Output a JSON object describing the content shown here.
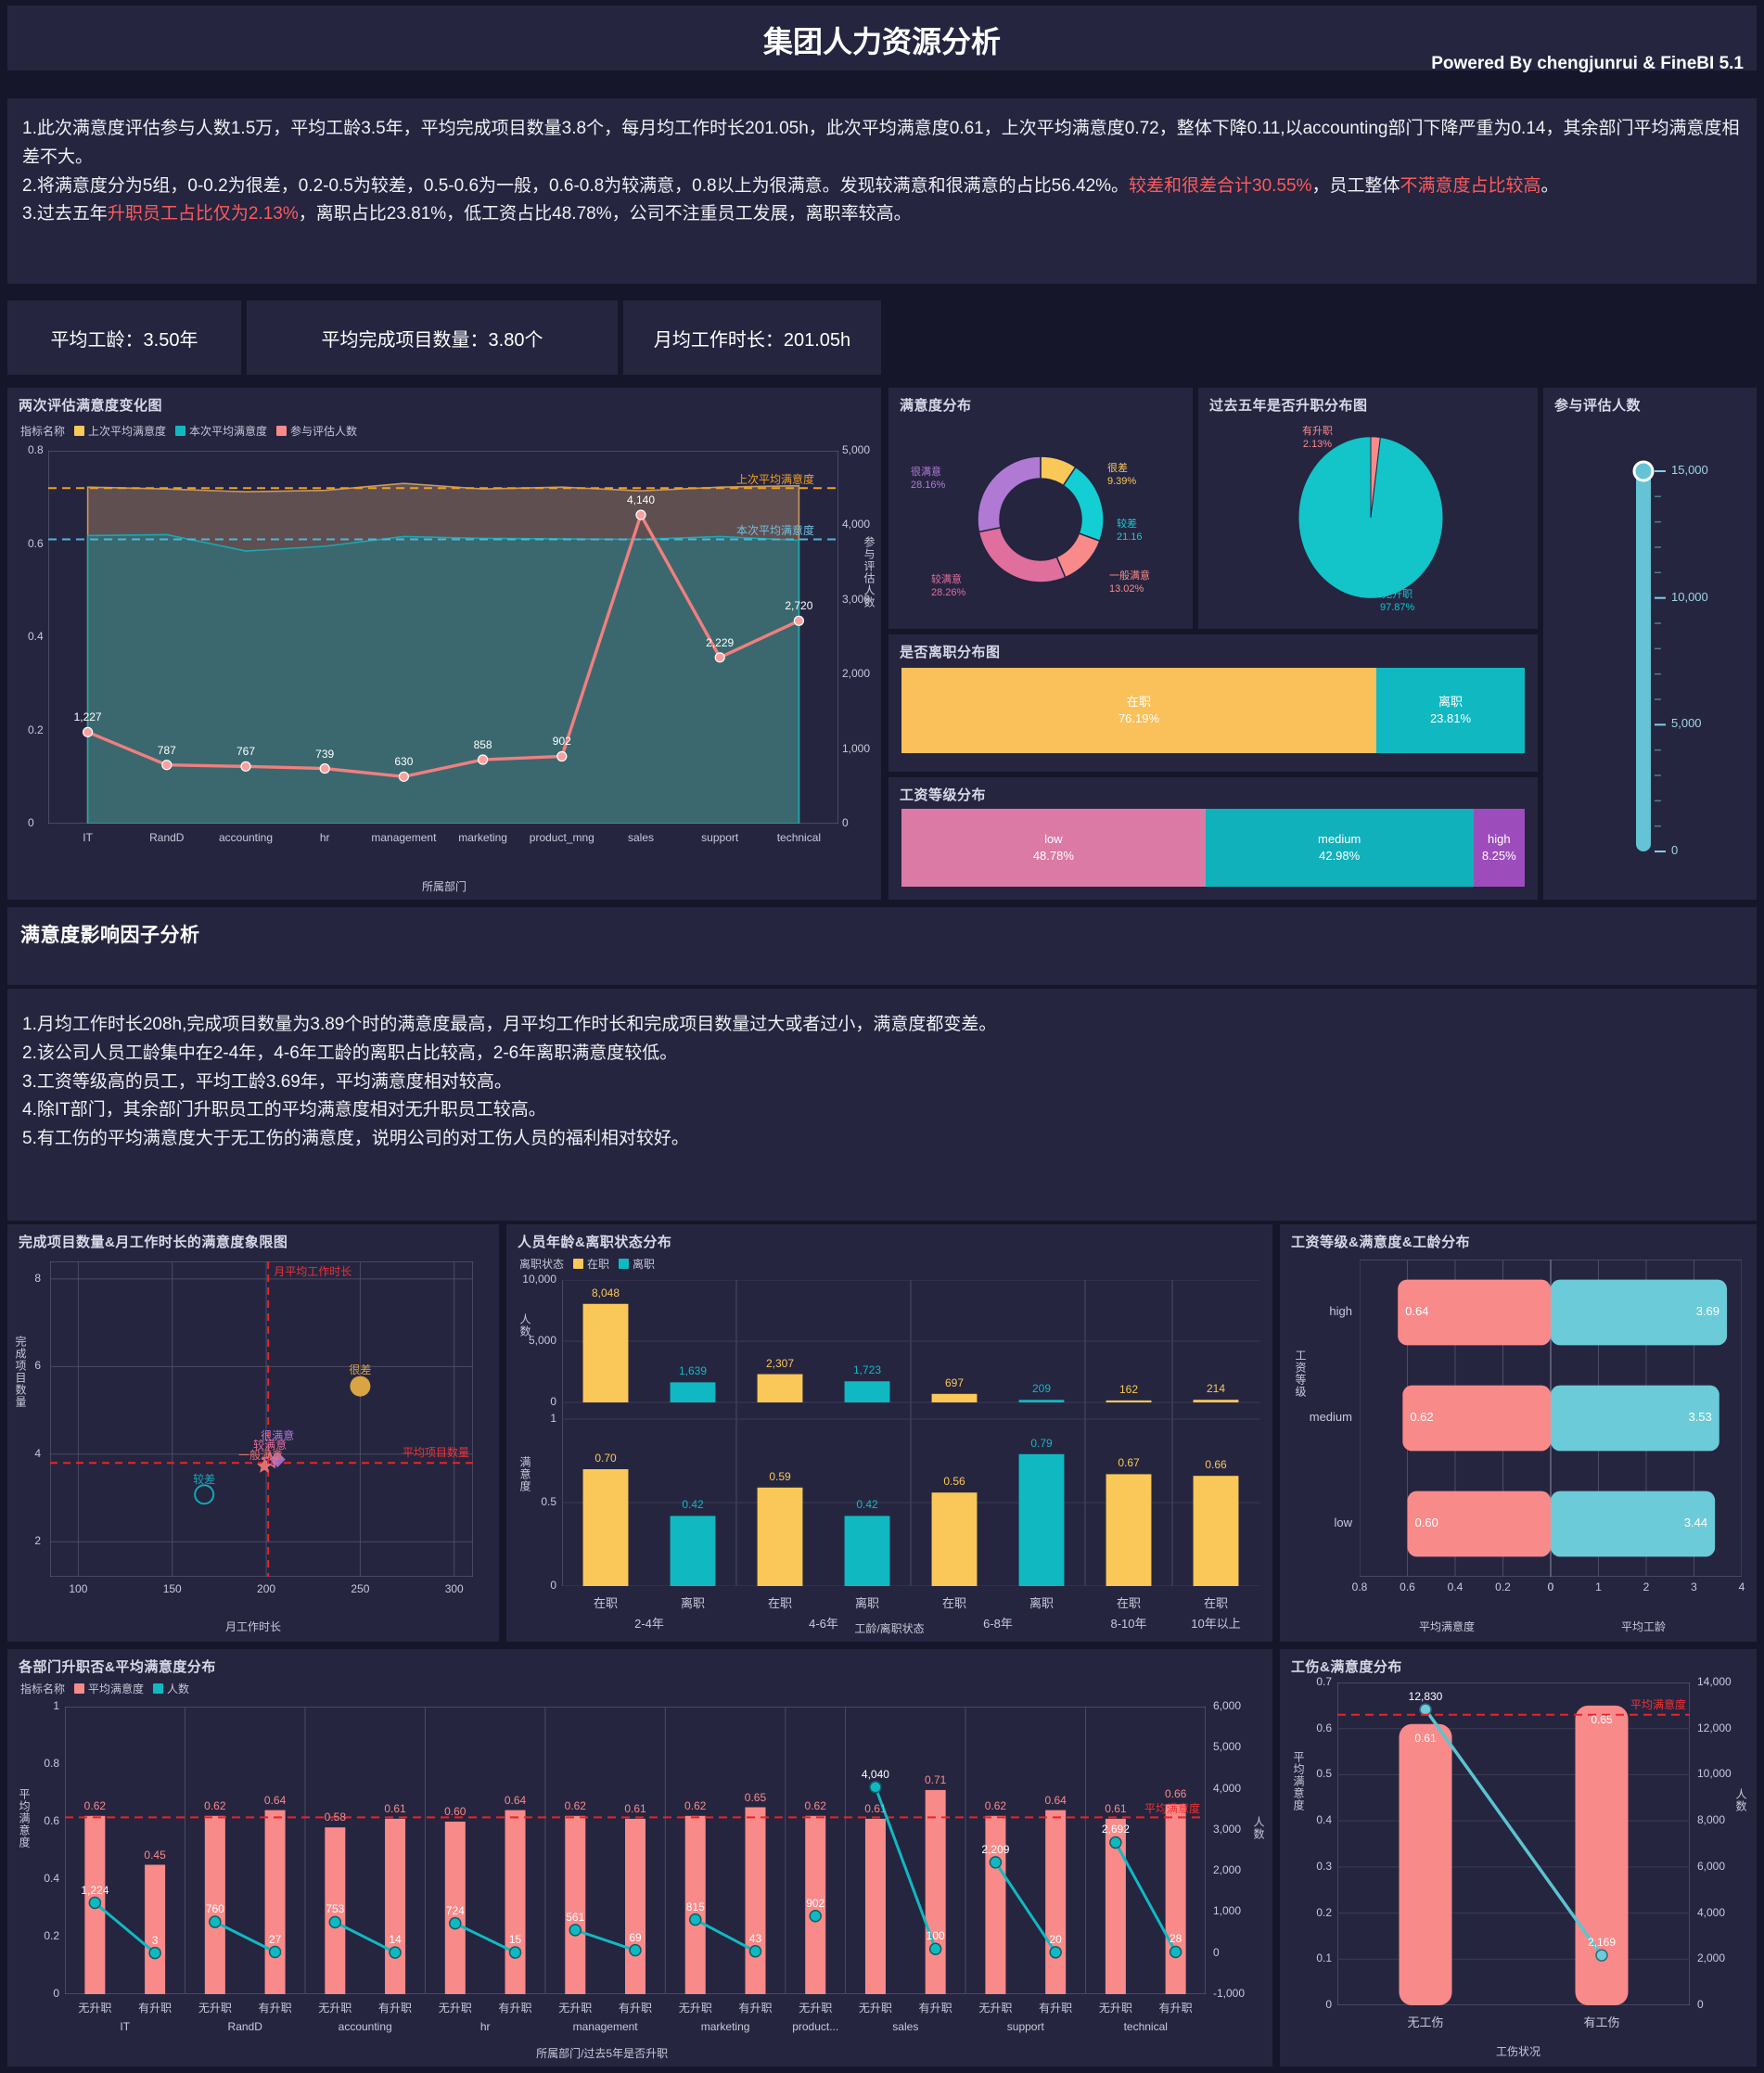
{
  "header": {
    "title": "集团人力资源分析",
    "powered_by": "Powered By chengjunrui & FineBI 5.1"
  },
  "summary": {
    "line1_a": "1.此次满意度评估参与人数1.5万，平均工龄3.5年，平均完成项目数量3.8个，每月均工作时长201.05h，此次平均满意度0.61，上次平均满意度0.72，整体下降0.11,以accounting部门下降严重为0.14，其余部门平均满意度相差不大。",
    "line2_a": "2.将满意度分为5组，0-0.2为很差，0.2-0.5为较差，0.5-0.6为一般，0.6-0.8为较满意，0.8以上为很满意。发现较满意和很满意的占比56.42%。",
    "line2_red1": "较差和很差合计30.55%",
    "line2_b": "，员工整体",
    "line2_red2": "不满意度占比较高",
    "line2_c": "。",
    "line3_a": "3.过去五年",
    "line3_red": "升职员工占比仅为2.13%",
    "line3_b": "，离职占比23.81%，低工资占比48.78%，公司不注重员工发展，离职率较高。"
  },
  "kpis": [
    {
      "label": "平均工龄：3.50年"
    },
    {
      "label": "平均完成项目数量：3.80个"
    },
    {
      "label": "月均工作时长：201.05h"
    }
  ],
  "section2": {
    "title": "满意度影响因子分析",
    "line1": "1.月均工作时长208h,完成项目数量为3.89个时的满意度最高，月平均工作时长和完成项目数量过大或者过小，满意度都变差。",
    "line2": "2.该公司人员工龄集中在2-4年，4-6年工龄的离职占比较高，2-6年离职满意度较低。",
    "line3": "3.工资等级高的员工，平均工龄3.69年，平均满意度相对较高。",
    "line4": "4.除IT部门，其余部门升职员工的平均满意度相对无升职员工较高。",
    "line5": "5.有工伤的平均满意度大于无工伤的满意度，说明公司的对工伤人员的福利相对较好。"
  },
  "colors": {
    "yellow": "#fac858",
    "teal": "#0bb8c4",
    "pink": "#f98a8a",
    "purple": "#b07ad4",
    "rose": "#dd6f9c",
    "red": "#ff2e2e",
    "cyan": "#6bc9d6"
  },
  "chart_data": [
    {
      "id": "line-chart",
      "type": "area",
      "title": "两次评估满意度变化图",
      "legend_label": "指标名称",
      "legend": [
        "上次平均满意度",
        "本次平均满意度",
        "参与评估人数"
      ],
      "xlabel": "所属部门",
      "ylabel_left": "",
      "ylabel_right": "参与评估人数",
      "categories": [
        "IT",
        "RandD",
        "accounting",
        "hr",
        "management",
        "marketing",
        "product_mng",
        "sales",
        "support",
        "technical"
      ],
      "yticks_left": [
        "0",
        "0.2",
        "0.4",
        "0.6",
        "0.8"
      ],
      "yticks_right": [
        "0",
        "1,000",
        "2,000",
        "3,000",
        "4,000",
        "5,000"
      ],
      "ylim_left": [
        0,
        0.8
      ],
      "ylim_right": [
        0,
        5000
      ],
      "series": [
        {
          "name": "上次平均满意度",
          "values": [
            0.722,
            0.718,
            0.712,
            0.715,
            0.73,
            0.718,
            0.722,
            0.714,
            0.722,
            0.725
          ]
        },
        {
          "name": "本次平均满意度",
          "values": [
            0.618,
            0.62,
            0.585,
            0.595,
            0.616,
            0.612,
            0.611,
            0.61,
            0.616,
            0.608
          ]
        },
        {
          "name": "参与评估人数",
          "values": [
            1227,
            787,
            767,
            739,
            630,
            858,
            902,
            4140,
            2229,
            2720
          ]
        }
      ],
      "ref_lines": [
        {
          "label": "上次平均满意度",
          "value": 0.72,
          "color": "#f0a020"
        },
        {
          "label": "本次平均满意度",
          "value": 0.61,
          "color": "#4ab8d6"
        }
      ]
    },
    {
      "id": "satisfaction-donut",
      "type": "pie",
      "title": "满意度分布",
      "slices": [
        {
          "label": "很差",
          "value": 9.39,
          "display": "9.39%",
          "color": "#fac858"
        },
        {
          "label": "较差",
          "value": 21.16,
          "display": "21.16",
          "color": "#13cfd4"
        },
        {
          "label": "一般满意",
          "value": 13.02,
          "display": "13.02%",
          "color": "#f98a8a"
        },
        {
          "label": "较满意",
          "value": 28.26,
          "display": "28.26%",
          "color": "#e06f9e"
        },
        {
          "label": "很满意",
          "value": 28.16,
          "display": "28.16%",
          "color": "#b07ad4"
        }
      ]
    },
    {
      "id": "promotion-pie",
      "type": "pie",
      "title": "过去五年是否升职分布图",
      "slices": [
        {
          "label": "有升职",
          "value": 2.13,
          "display": "2.13%",
          "color": "#f98a8a"
        },
        {
          "label": "无升职",
          "value": 97.87,
          "display": "97.87%",
          "color": "#13c4c9"
        }
      ]
    },
    {
      "id": "quit-bar",
      "type": "bar",
      "title": "是否离职分布图",
      "slices": [
        {
          "label": "在职",
          "value": 76.19,
          "display": "76.19%",
          "color": "#fac05a"
        },
        {
          "label": "离职",
          "value": 23.81,
          "display": "23.81%",
          "color": "#10b9c2"
        }
      ]
    },
    {
      "id": "salary-bar",
      "type": "bar",
      "title": "工资等级分布",
      "slices": [
        {
          "label": "low",
          "value": 48.78,
          "display": "48.78%",
          "color": "#db7aa5"
        },
        {
          "label": "medium",
          "value": 42.98,
          "display": "42.98%",
          "color": "#10b1bb"
        },
        {
          "label": "high",
          "value": 8.25,
          "display": "8.25%",
          "color": "#9c4dbb"
        }
      ]
    },
    {
      "id": "participant-gauge",
      "type": "bar",
      "title": "参与评估人数",
      "value": 15000,
      "ticks": [
        "0",
        "5,000",
        "10,000",
        "15,000"
      ],
      "ylim": [
        0,
        15000
      ]
    },
    {
      "id": "quadrant-scatter",
      "type": "scatter",
      "title": "完成项目数量&月工作时长的满意度象限图",
      "xlabel": "月工作时长",
      "ylabel": "完成项目数量",
      "xticks": [
        "100",
        "150",
        "200",
        "250",
        "300"
      ],
      "yticks": [
        "2",
        "4",
        "6",
        "8"
      ],
      "xlim": [
        85,
        310
      ],
      "ylim": [
        1.2,
        8.4
      ],
      "ref_x": {
        "label": "月平均工作时长",
        "value": 201.05
      },
      "ref_y": {
        "label": "平均项目数量",
        "value": 3.8
      },
      "points": [
        {
          "label": "很差",
          "x": 250,
          "y": 5.55,
          "color": "#d9a441",
          "shape": "circle-filled",
          "size": 22
        },
        {
          "label": "很满意",
          "x": 206,
          "y": 3.88,
          "color": "#b07ad4",
          "shape": "diamond",
          "size": 17
        },
        {
          "label": "较满意",
          "x": 202,
          "y": 3.85,
          "color": "#e06f9e",
          "shape": "star-outline",
          "size": 17
        },
        {
          "label": "一般满意",
          "x": 199,
          "y": 3.72,
          "color": "#e07070",
          "shape": "star-filled",
          "size": 17
        },
        {
          "label": "较差",
          "x": 167,
          "y": 3.08,
          "color": "#13a8b4",
          "shape": "circle-outline",
          "size": 20
        }
      ]
    },
    {
      "id": "age-quit-bar",
      "type": "bar",
      "title": "人员年龄&离职状态分布",
      "legend_label": "离职状态",
      "legend": [
        "在职",
        "离职"
      ],
      "xlabel": "工龄/离职状态",
      "ylabel_top": "人数",
      "ylabel_bottom": "满意度",
      "groups": [
        "2-4年",
        "4-6年",
        "6-8年",
        "8-10年",
        "10年以上"
      ],
      "yticks_top": [
        "0",
        "5,000",
        "10,000"
      ],
      "yticks_bottom": [
        "0",
        "0.5",
        "1"
      ],
      "bars": [
        {
          "group": "2-4年",
          "status": "在职",
          "count": 8048,
          "count_display": "8,048",
          "satisfaction": 0.7,
          "color": "#fac858"
        },
        {
          "group": "2-4年",
          "status": "离职",
          "count": 1639,
          "count_display": "1,639",
          "satisfaction": 0.42,
          "color": "#10b9c2"
        },
        {
          "group": "4-6年",
          "status": "在职",
          "count": 2307,
          "count_display": "2,307",
          "satisfaction": 0.59,
          "color": "#fac858"
        },
        {
          "group": "4-6年",
          "status": "离职",
          "count": 1723,
          "count_display": "1,723",
          "satisfaction": 0.42,
          "color": "#10b9c2"
        },
        {
          "group": "6-8年",
          "status": "在职",
          "count": 697,
          "count_display": "697",
          "satisfaction": 0.56,
          "color": "#fac858"
        },
        {
          "group": "6-8年",
          "status": "离职",
          "count": 209,
          "count_display": "209",
          "satisfaction": 0.79,
          "color": "#10b9c2"
        },
        {
          "group": "8-10年",
          "status": "在职",
          "count": 162,
          "count_display": "162",
          "satisfaction": 0.67,
          "color": "#fac858"
        },
        {
          "group": "10年以上",
          "status": "在职",
          "count": 214,
          "count_display": "214",
          "satisfaction": 0.66,
          "color": "#fac858"
        }
      ]
    },
    {
      "id": "salary-grade-bar",
      "type": "bar",
      "title": "工资等级&满意度&工龄分布",
      "ylabel": "工资等级",
      "xlabel_left": "平均满意度",
      "xlabel_right": "平均工龄",
      "xticks_left": [
        "0.8",
        "0.6",
        "0.4",
        "0.2",
        "0"
      ],
      "xticks_right": [
        "0",
        "1",
        "2",
        "3",
        "4"
      ],
      "rows": [
        {
          "grade": "high",
          "satisfaction": 0.64,
          "satisfaction_display": "0.64",
          "tenure": 3.69,
          "tenure_display": "3.69"
        },
        {
          "grade": "medium",
          "satisfaction": 0.62,
          "satisfaction_display": "0.62",
          "tenure": 3.53,
          "tenure_display": "3.53"
        },
        {
          "grade": "low",
          "satisfaction": 0.6,
          "satisfaction_display": "0.60",
          "tenure": 3.44,
          "tenure_display": "3.44"
        }
      ]
    },
    {
      "id": "dept-promotion-bar",
      "type": "bar",
      "title": "各部门升职否&平均满意度分布",
      "legend_label": "指标名称",
      "legend": [
        "平均满意度",
        "人数"
      ],
      "xlabel": "所属部门/过去5年是否升职",
      "ylabel_left": "平均满意度",
      "ylabel_right": "人数",
      "yticks_left": [
        "0",
        "0.2",
        "0.4",
        "0.6",
        "0.8",
        "1"
      ],
      "yticks_right": [
        "-1,000",
        "0",
        "1,000",
        "2,000",
        "3,000",
        "4,000",
        "5,000",
        "6,000"
      ],
      "ref_line": {
        "label": "平均满意度",
        "value": 0.615
      },
      "departments": [
        "IT",
        "RandD",
        "accounting",
        "hr",
        "management",
        "marketing",
        "product...",
        "sales",
        "support",
        "technical"
      ],
      "bars": [
        {
          "dept": "IT",
          "promo": "无升职",
          "satisfaction": 0.62,
          "count": 1224,
          "count_display": "1,224"
        },
        {
          "dept": "IT",
          "promo": "有升职",
          "satisfaction": 0.45,
          "count": 3,
          "count_display": "3"
        },
        {
          "dept": "RandD",
          "promo": "无升职",
          "satisfaction": 0.62,
          "count": 760,
          "count_display": "760"
        },
        {
          "dept": "RandD",
          "promo": "有升职",
          "satisfaction": 0.64,
          "count": 27,
          "count_display": "27"
        },
        {
          "dept": "accounting",
          "promo": "无升职",
          "satisfaction": 0.58,
          "count": 753,
          "count_display": "753"
        },
        {
          "dept": "accounting",
          "promo": "有升职",
          "satisfaction": 0.61,
          "count": 14,
          "count_display": "14"
        },
        {
          "dept": "hr",
          "promo": "无升职",
          "satisfaction": 0.6,
          "count": 724,
          "count_display": "724"
        },
        {
          "dept": "hr",
          "promo": "有升职",
          "satisfaction": 0.64,
          "count": 15,
          "count_display": "15"
        },
        {
          "dept": "management",
          "promo": "无升职",
          "satisfaction": 0.62,
          "count": 561,
          "count_display": "561"
        },
        {
          "dept": "management",
          "promo": "有升职",
          "satisfaction": 0.61,
          "count": 69,
          "count_display": "69"
        },
        {
          "dept": "marketing",
          "promo": "无升职",
          "satisfaction": 0.62,
          "count": 815,
          "count_display": "815"
        },
        {
          "dept": "marketing",
          "promo": "有升职",
          "satisfaction": 0.65,
          "count": 43,
          "count_display": "43"
        },
        {
          "dept": "product...",
          "promo": "无升职",
          "satisfaction": 0.62,
          "count": 902,
          "count_display": "902"
        },
        {
          "dept": "sales",
          "promo": "无升职",
          "satisfaction": 0.61,
          "count": 4040,
          "count_display": "4,040"
        },
        {
          "dept": "sales",
          "promo": "有升职",
          "satisfaction": 0.71,
          "count": 100,
          "count_display": "100"
        },
        {
          "dept": "support",
          "promo": "无升职",
          "satisfaction": 0.62,
          "count": 2209,
          "count_display": "2,209"
        },
        {
          "dept": "support",
          "promo": "有升职",
          "satisfaction": 0.64,
          "count": 20,
          "count_display": "20"
        },
        {
          "dept": "technical",
          "promo": "无升职",
          "satisfaction": 0.61,
          "count": 2692,
          "count_display": "2,692"
        },
        {
          "dept": "technical",
          "promo": "有升职",
          "satisfaction": 0.66,
          "count": 28,
          "count_display": "28"
        }
      ]
    },
    {
      "id": "injury-bar",
      "type": "bar",
      "title": "工伤&满意度分布",
      "xlabel": "工伤状况",
      "ylabel_left": "平均满意度",
      "ylabel_right": "人数",
      "yticks_left": [
        "0",
        "0.1",
        "0.2",
        "0.3",
        "0.4",
        "0.5",
        "0.6",
        "0.7"
      ],
      "yticks_right": [
        "0",
        "2,000",
        "4,000",
        "6,000",
        "8,000",
        "10,000",
        "12,000",
        "14,000"
      ],
      "ref_line": {
        "label": "平均满意度",
        "value": 0.63
      },
      "categories": [
        "无工伤",
        "有工伤"
      ],
      "satisfaction": [
        0.61,
        0.65
      ],
      "satisfaction_display": [
        "0.61",
        "0.65"
      ],
      "counts": [
        12830,
        2169
      ],
      "counts_display": [
        "12,830",
        "2,169"
      ]
    }
  ]
}
